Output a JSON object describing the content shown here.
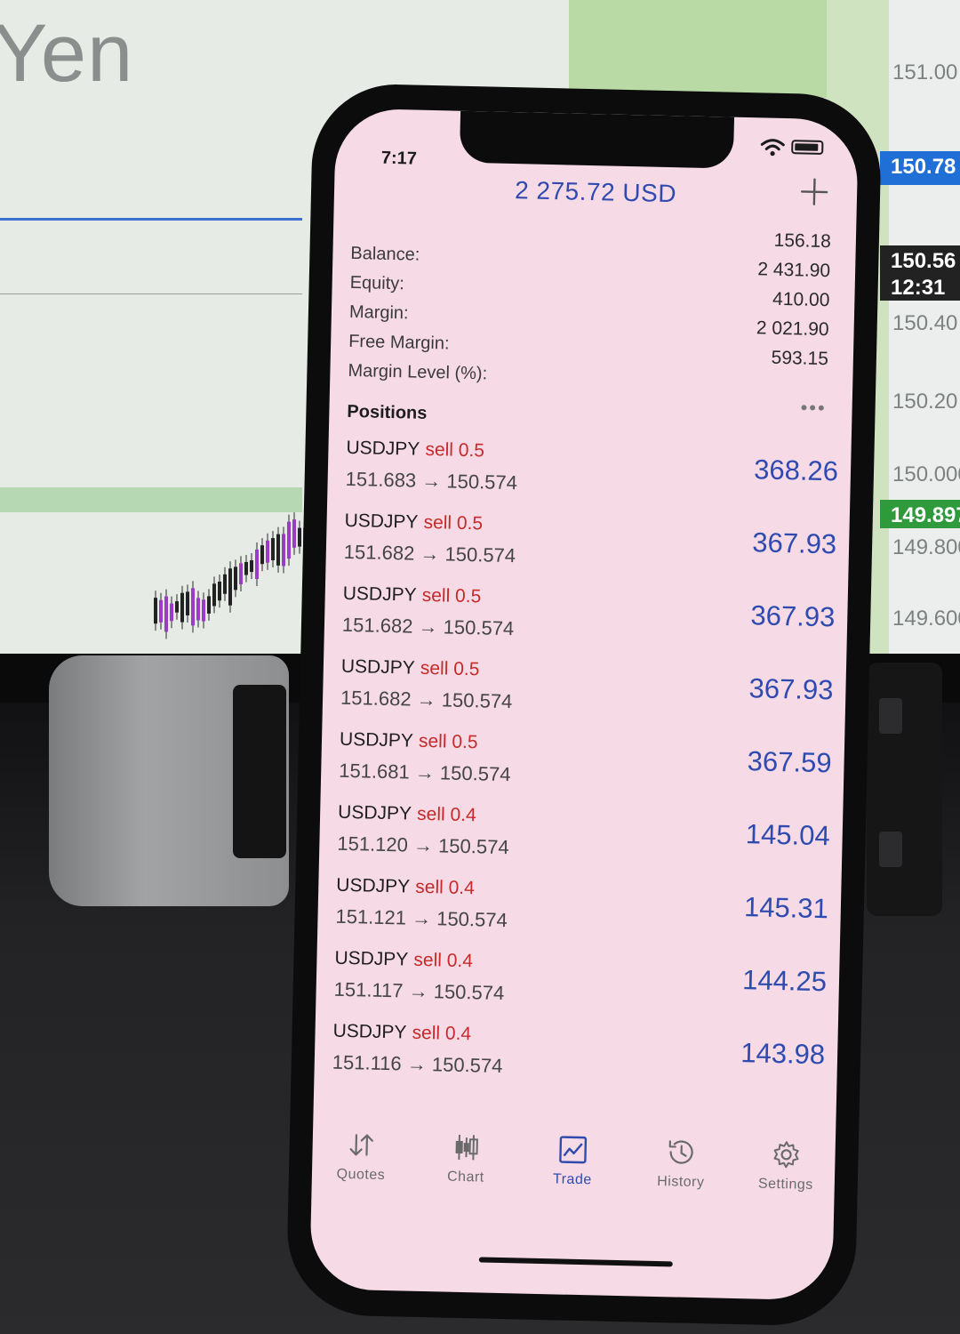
{
  "background": {
    "chart_title_fragment": "Yen",
    "price_labels": [
      "151.00",
      "150.40",
      "150.20",
      "150.000",
      "149.800",
      "149.600"
    ],
    "price_tags": [
      {
        "text": "150.78",
        "color": "#1f6fd6"
      },
      {
        "text": "150.56",
        "color": "#222222"
      },
      {
        "text": "12:31",
        "color": "#222222"
      },
      {
        "text": "149.897",
        "color": "#2e9a3b"
      }
    ]
  },
  "status_bar": {
    "time": "7:17"
  },
  "header": {
    "total_profit": "2 275.72 USD",
    "add_icon": "plus-icon"
  },
  "account": [
    {
      "label": "Balance:",
      "value": "156.18"
    },
    {
      "label": "Equity:",
      "value": "2 431.90"
    },
    {
      "label": "Margin:",
      "value": "410.00"
    },
    {
      "label": "Free Margin:",
      "value": "2 021.90"
    },
    {
      "label": "Margin Level (%):",
      "value": "593.15"
    }
  ],
  "positions": {
    "title": "Positions",
    "more_icon": "ellipsis-icon",
    "items": [
      {
        "symbol": "USDJPY",
        "type": "sell 0.5",
        "prices": "151.683 → 150.574",
        "profit": "368.26"
      },
      {
        "symbol": "USDJPY",
        "type": "sell 0.5",
        "prices": "151.682 → 150.574",
        "profit": "367.93"
      },
      {
        "symbol": "USDJPY",
        "type": "sell 0.5",
        "prices": "151.682 → 150.574",
        "profit": "367.93"
      },
      {
        "symbol": "USDJPY",
        "type": "sell 0.5",
        "prices": "151.682 → 150.574",
        "profit": "367.93"
      },
      {
        "symbol": "USDJPY",
        "type": "sell 0.5",
        "prices": "151.681 → 150.574",
        "profit": "367.59"
      },
      {
        "symbol": "USDJPY",
        "type": "sell 0.4",
        "prices": "151.120 → 150.574",
        "profit": "145.04"
      },
      {
        "symbol": "USDJPY",
        "type": "sell 0.4",
        "prices": "151.121 → 150.574",
        "profit": "145.31"
      },
      {
        "symbol": "USDJPY",
        "type": "sell 0.4",
        "prices": "151.117 → 150.574",
        "profit": "144.25"
      },
      {
        "symbol": "USDJPY",
        "type": "sell 0.4",
        "prices": "151.116 → 150.574",
        "profit": "143.98"
      }
    ]
  },
  "tabs": [
    {
      "label": "Quotes",
      "icon": "quotes-arrows-icon",
      "active": false
    },
    {
      "label": "Chart",
      "icon": "candlestick-icon",
      "active": false
    },
    {
      "label": "Trade",
      "icon": "trade-chart-icon",
      "active": true
    },
    {
      "label": "History",
      "icon": "history-clock-icon",
      "active": false
    },
    {
      "label": "Settings",
      "icon": "gear-icon",
      "active": false
    }
  ],
  "colors": {
    "accent": "#2f4bb0",
    "sell": "#c62a2a",
    "screen_bg": "#f6dbe6"
  }
}
